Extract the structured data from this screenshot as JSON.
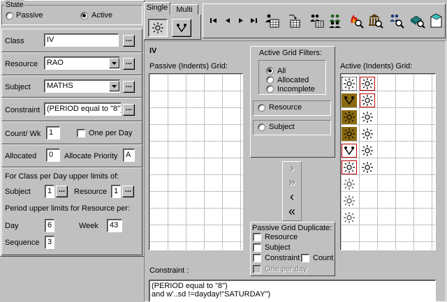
{
  "state": {
    "title": "State",
    "passive_label": "Passive",
    "active_label": "Active",
    "selected": "Active"
  },
  "class": {
    "label": "Class",
    "value": "IV"
  },
  "resource": {
    "label": "Resource",
    "value": "RAO"
  },
  "subject": {
    "label": "Subject",
    "value": "MATHS"
  },
  "constraint_field": {
    "label": "Constraint",
    "value": "(PERIOD equal to \"8\")"
  },
  "count": {
    "label": "Count/ Wk",
    "value": "1",
    "one_per_day_label": "One per Day"
  },
  "allocated": {
    "label": "Allocated",
    "value": "0",
    "priority_label": "Allocate Priority",
    "priority_value": "A"
  },
  "class_limits": {
    "heading": "For Class per Day upper limits of:",
    "subject_label": "Subject",
    "subject_value": "1",
    "resource_label": "Resource",
    "resource_value": "1"
  },
  "resource_limits": {
    "heading": "Period upper limits for Resource per:",
    "day_label": "Day",
    "day_value": "6",
    "week_label": "Week",
    "week_value": "43",
    "sequence_label": "Sequence",
    "sequence_value": "3"
  },
  "ellipsis": "...",
  "tabs": {
    "single": "Single",
    "multi": "Multi",
    "active": "Single"
  },
  "toolbar": {
    "nav": [
      "⏮",
      "◀",
      "▶",
      "⏭"
    ],
    "icons": [
      "class-calendar-icon",
      "calendar-arrow-icon",
      "people-calendar-icon",
      "people-group-icon",
      "fire-zoom-icon",
      "building-zoom-icon",
      "people-zoom-icon",
      "book-zoom-icon",
      "page-icon"
    ]
  },
  "main": {
    "class_title": "IV",
    "passive_grid_label": "Passive (Indents) Grid:",
    "active_grid_label": "Active (Indents) Grid:",
    "constraint_label": "Constraint :",
    "constraint_lines": [
      "(PERIOD equal to \"8\")",
      "and w'..sd !=dayday!\"SATURDAY\")"
    ]
  },
  "filters": {
    "title": "Active Grid Filters:",
    "all": "All",
    "allocated": "Allocated",
    "incomplete": "Incomplete",
    "selected": "All",
    "resource": "Resource",
    "subject": "Subject"
  },
  "transfer": {
    "right": "›",
    "all_right": "»",
    "left": "‹",
    "all_left": "«"
  },
  "duplicate": {
    "title": "Passive Grid Duplicate:",
    "resource": "Resource",
    "subject": "Subject",
    "constraint": "Constraint",
    "count": "Count",
    "one_per_day": "One per day"
  },
  "active_grid": {
    "rows": [
      [
        "sun-boxed-selected",
        "sun-boxed-red"
      ],
      [
        "people-brown-sun",
        "sun-boxed-red"
      ],
      [
        "sun-brown",
        "sun"
      ],
      [
        "sun-brown",
        "sun"
      ],
      [
        "people-boxed-red",
        "sun"
      ],
      [
        "sun-boxed-red",
        "sun"
      ],
      [
        "sun-light",
        ""
      ],
      [
        "sun-light",
        ""
      ],
      [
        "sun-light",
        ""
      ]
    ]
  },
  "colors": {
    "face": "#c0c0c0",
    "brown": "#8a6a10",
    "red": "#c00000"
  }
}
